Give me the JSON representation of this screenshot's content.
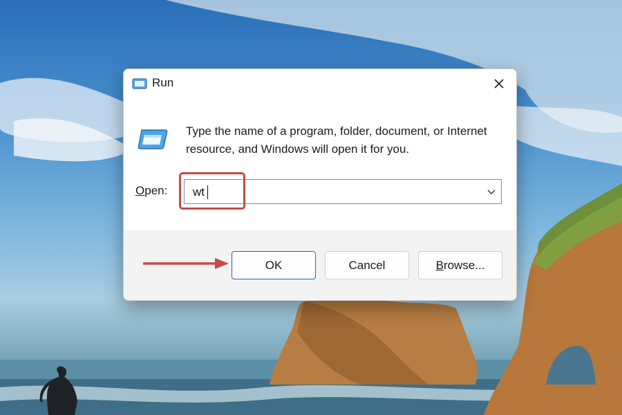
{
  "dialog": {
    "title": "Run",
    "description": "Type the name of a program, folder, document, or Internet resource, and Windows will open it for you.",
    "open_label_accel": "O",
    "open_label_rest": "pen:",
    "open_value": "wt",
    "buttons": {
      "ok": "OK",
      "cancel": "Cancel",
      "browse_accel": "B",
      "browse_rest": "rowse..."
    }
  },
  "icons": {
    "title": "run-icon",
    "close": "close-icon",
    "dropdown": "chevron-down-icon"
  },
  "colors": {
    "annotation": "#c64a47",
    "focus_border": "#1e66c1"
  }
}
